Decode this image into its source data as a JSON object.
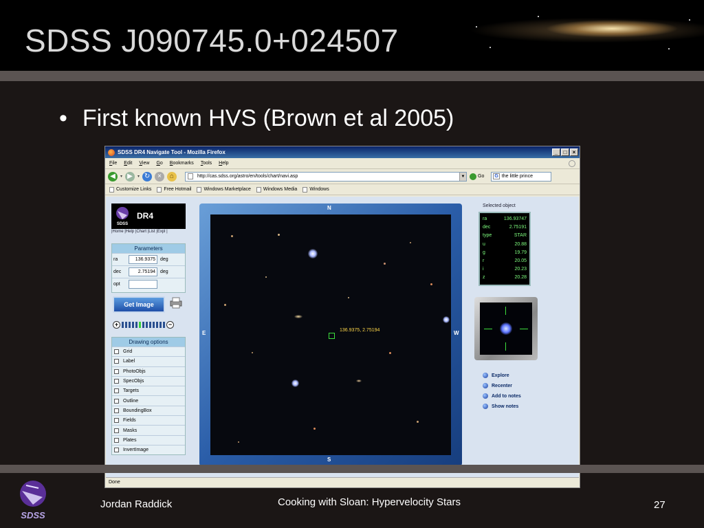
{
  "slide": {
    "title": "SDSS J090745.0+024507",
    "bullet_symbol": "•",
    "bullet_text": "First known HVS (Brown et al 2005)",
    "footer": {
      "author": "Jordan Raddick",
      "center": "Cooking with Sloan: Hypervelocity Stars",
      "page_number": "27"
    }
  },
  "browser": {
    "window_title": "SDSS DR4 Navigate Tool - Mozilla Firefox",
    "window_buttons": [
      "_",
      "□",
      "×"
    ],
    "menu": [
      {
        "underline": "F",
        "rest": "ile"
      },
      {
        "underline": "E",
        "rest": "dit"
      },
      {
        "underline": "V",
        "rest": "iew"
      },
      {
        "underline": "G",
        "rest": "o"
      },
      {
        "underline": "B",
        "rest": "ookmarks"
      },
      {
        "underline": "T",
        "rest": "ools"
      },
      {
        "underline": "H",
        "rest": "elp"
      }
    ],
    "url": "http://cas.sdss.org/astro/en/tools/chart/navi.asp",
    "go_label": "Go",
    "search_engine_letter": "G",
    "search_text": "the little prince",
    "bookmarks": [
      "Customize Links",
      "Free Hotmail",
      "Windows Marketplace",
      "Windows Media",
      "Windows"
    ],
    "status_text": "Done"
  },
  "navigate_tool": {
    "logo_text": "DR4",
    "logo_badge_text": "SDSS",
    "top_links": "|Home |Help |Chart |List |Expl |",
    "parameters": {
      "heading": "Parameters",
      "ra": {
        "label": "ra",
        "value": "136.9375",
        "unit": "deg"
      },
      "dec": {
        "label": "dec",
        "value": "2.75194",
        "unit": "deg"
      },
      "opt": {
        "label": "opt",
        "value": ""
      }
    },
    "get_image_label": "Get Image",
    "zoom": {
      "minus_glyph": "−",
      "plus_glyph": "+",
      "levels": 13,
      "selected_level": 5
    },
    "drawing_options": {
      "heading": "Drawing options",
      "items": [
        "Grid",
        "Label",
        "PhotoObjs",
        "SpecObjs",
        "Targets",
        "Outline",
        "BoundingBox",
        "Fields",
        "Masks",
        "Plates",
        "InvertImage"
      ]
    },
    "sky": {
      "north": "N",
      "south": "S",
      "east": "E",
      "west": "W",
      "target_label": "136.9375, 2.75194"
    },
    "selected_object": {
      "heading": "Selected object",
      "rows": [
        {
          "key": "ra",
          "value": "136.93747"
        },
        {
          "key": "dec",
          "value": "2.75191"
        },
        {
          "key": "type",
          "value": "STAR"
        },
        {
          "key": "u",
          "value": "20.88"
        },
        {
          "key": "g",
          "value": "19.79"
        },
        {
          "key": "r",
          "value": "20.05"
        },
        {
          "key": "i",
          "value": "20.23"
        },
        {
          "key": "z",
          "value": "20.28"
        }
      ]
    },
    "actions": [
      "Explore",
      "Recenter",
      "Add to notes",
      "Show notes"
    ]
  },
  "colors": {
    "title_text": "#d9d9d9",
    "slide_background": "#1b1615",
    "table_text_green": "#7fff7f",
    "target_label_yellow": "#ffd84a"
  }
}
